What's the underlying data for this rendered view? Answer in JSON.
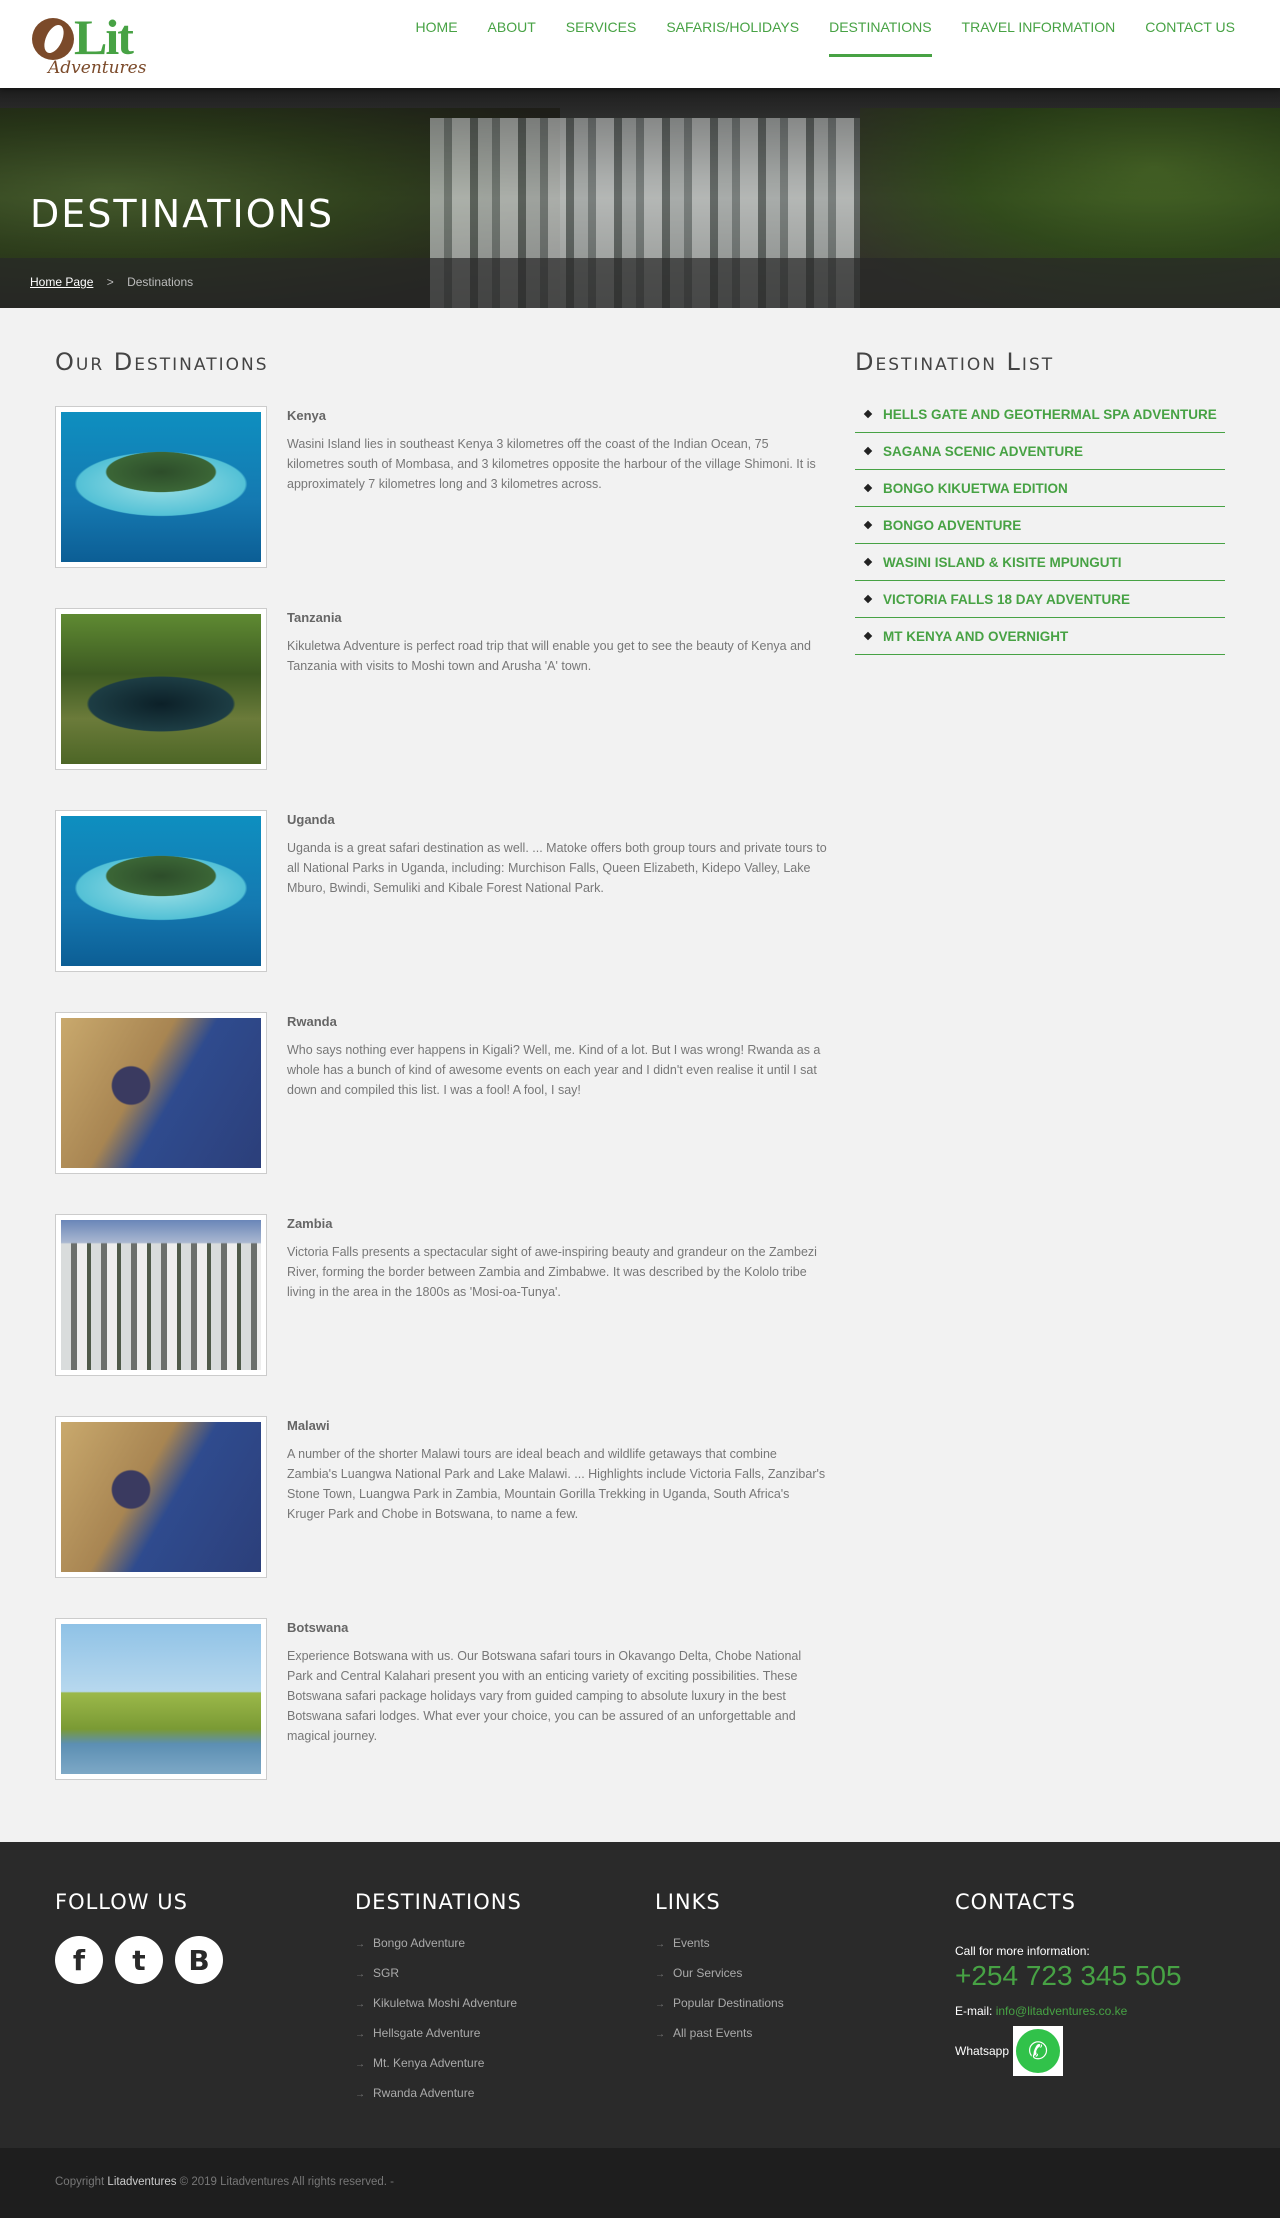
{
  "header": {
    "logo_text": "Lit",
    "logo_sub": "Adventures",
    "nav": [
      "HOME",
      "ABOUT",
      "SERVICES",
      "SAFARIS/HOLIDAYS",
      "DESTINATIONS",
      "TRAVEL INFORMATION",
      "CONTACT US"
    ],
    "active": "DESTINATIONS"
  },
  "hero": {
    "title": "DESTINATIONS",
    "breadcrumb": {
      "home": "Home Page",
      "sep": ">",
      "current": "Destinations"
    }
  },
  "left": {
    "title": "Our Destinations",
    "items": [
      {
        "name": "Kenya",
        "text": "Wasini Island lies in southeast Kenya 3 kilometres off the coast of the Indian Ocean, 75 kilometres south of Mombasa, and 3 kilometres opposite the harbour of the village Shimoni. It is approximately 7 kilometres long and 3 kilometres across."
      },
      {
        "name": "Tanzania",
        "text": "Kikuletwa Adventure is perfect road trip that will enable you get to see the beauty of Kenya and Tanzania with visits to Moshi town and Arusha 'A' town."
      },
      {
        "name": "Uganda",
        "text": "Uganda is a great safari destination as well. ... Matoke offers both group tours and private tours to all National Parks in Uganda, including: Murchison Falls, Queen Elizabeth, Kidepo Valley, Lake Mburo, Bwindi, Semuliki and Kibale Forest National Park."
      },
      {
        "name": "Rwanda",
        "text": "Who says nothing ever happens in Kigali? Well, me. Kind of a lot. But I was wrong! Rwanda as a whole has a bunch of kind of awesome events on each year and I didn't even realise it until I sat down and compiled this list. I was a fool! A fool, I say!"
      },
      {
        "name": "Zambia",
        "text": "Victoria Falls presents a spectacular sight of awe-inspiring beauty and grandeur on the Zambezi River, forming the border between Zambia and Zimbabwe. It was described by the Kololo tribe living in the area in the 1800s as 'Mosi-oa-Tunya'."
      },
      {
        "name": "Malawi",
        "text": "A number of the shorter Malawi tours are ideal beach and wildlife getaways that combine Zambia's Luangwa National Park and Lake Malawi. ... Highlights include Victoria Falls, Zanzibar's Stone Town, Luangwa Park in Zambia, Mountain Gorilla Trekking in Uganda, South Africa's Kruger Park and Chobe in Botswana, to name a few."
      },
      {
        "name": "Botswana",
        "text": "Experience Botswana with us. Our Botswana safari tours in Okavango Delta, Chobe National Park and Central Kalahari present you with an enticing variety of exciting possibilities. These Botswana safari package holidays vary from guided camping to absolute luxury in the best Botswana safari lodges. What ever your choice, you can be assured of an unforgettable and magical journey."
      }
    ]
  },
  "right": {
    "title": "Destination List",
    "items": [
      "HELLS GATE AND GEOTHERMAL SPA ADVENTURE",
      "SAGANA SCENIC ADVENTURE",
      "BONGO KIKUETWA EDITION",
      "BONGO ADVENTURE",
      "WASINI ISLAND & KISITE MPUNGUTI",
      "VICTORIA FALLS 18 DAY ADVENTURE",
      "MT KENYA AND OVERNIGHT"
    ]
  },
  "footer": {
    "follow": "FOLLOW US",
    "social": [
      {
        "icon": "facebook-icon",
        "glyph": "f"
      },
      {
        "icon": "twitter-icon",
        "glyph": "t"
      },
      {
        "icon": "blogger-icon",
        "glyph": "B"
      }
    ],
    "destinations_title": "DESTINATIONS",
    "destinations": [
      "Bongo Adventure",
      "SGR",
      "Kikuletwa Moshi Adventure",
      "Hellsgate Adventure",
      "Mt. Kenya Adventure",
      "Rwanda Adventure"
    ],
    "links_title": "LINKS",
    "links": [
      "Events",
      "Our Services",
      "Popular Destinations",
      "All past Events"
    ],
    "contacts_title": "CONTACTS",
    "call_label": "Call for more information:",
    "phone": "+254 723 345 505",
    "email_label": "E-mail:",
    "email": "info@litadventures.co.ke",
    "whatsapp_label": "Whatsapp",
    "copyright_pre": "Copyright",
    "copyright_link": "Litadventures",
    "copyright_post": "© 2019 Litadventures All rights reserved.   -"
  },
  "colors": {
    "accent": "#47a244",
    "footer_bg": "#2a2a2a"
  }
}
